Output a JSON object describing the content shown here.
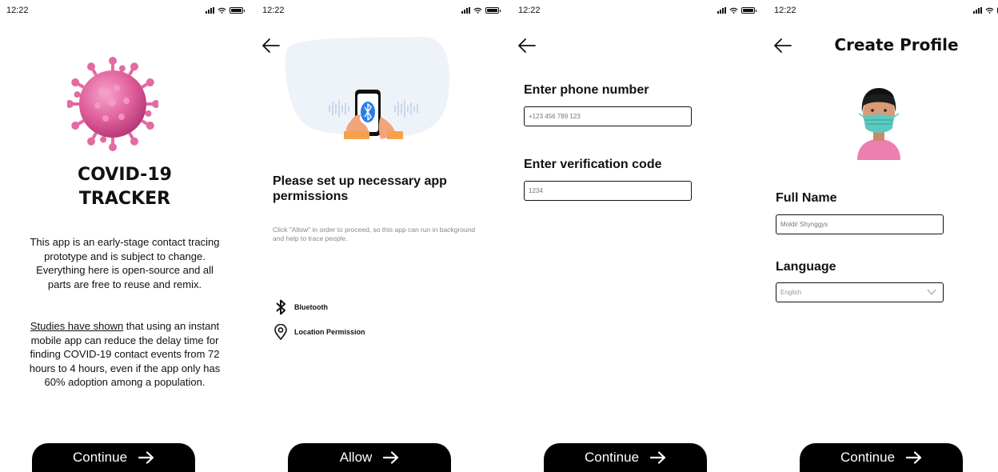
{
  "status": {
    "time": "12:22"
  },
  "screen1": {
    "title_line1": "COVID-19",
    "title_line2": "TRACKER",
    "para1": "This app is an early-stage contact tracing prototype and is subject to change. Everything here is open-source and all parts are free to reuse and remix.",
    "para2_link": "Studies have shown",
    "para2_rest": " that using an instant mobile app can reduce the delay time for finding COVID-19 contact events from 72 hours to 4 hours, even if the app only has 60% adoption among a population.",
    "button": "Continue",
    "virus_color": "#e76aa4"
  },
  "screen2": {
    "title": "Please set up necessary app permissions",
    "description": "Click \"Allow\" in order to proceed, so this app can run in background and help to trace people.",
    "permissions": [
      {
        "label": "Bluetooth",
        "icon": "bluetooth-icon"
      },
      {
        "label": "Location Permission",
        "icon": "location-pin-icon"
      }
    ],
    "button": "Allow",
    "accent": "#2b7de9"
  },
  "screen3": {
    "phone_label": "Enter phone number",
    "phone_placeholder": "+123 456 789 123",
    "code_label": "Enter verification code",
    "code_placeholder": "1234",
    "button": "Continue"
  },
  "screen4": {
    "title": "Create Profile",
    "name_label": "Full Name",
    "name_placeholder": "Moldir Shynggys",
    "language_label": "Language",
    "language_value": "English",
    "button": "Continue"
  }
}
